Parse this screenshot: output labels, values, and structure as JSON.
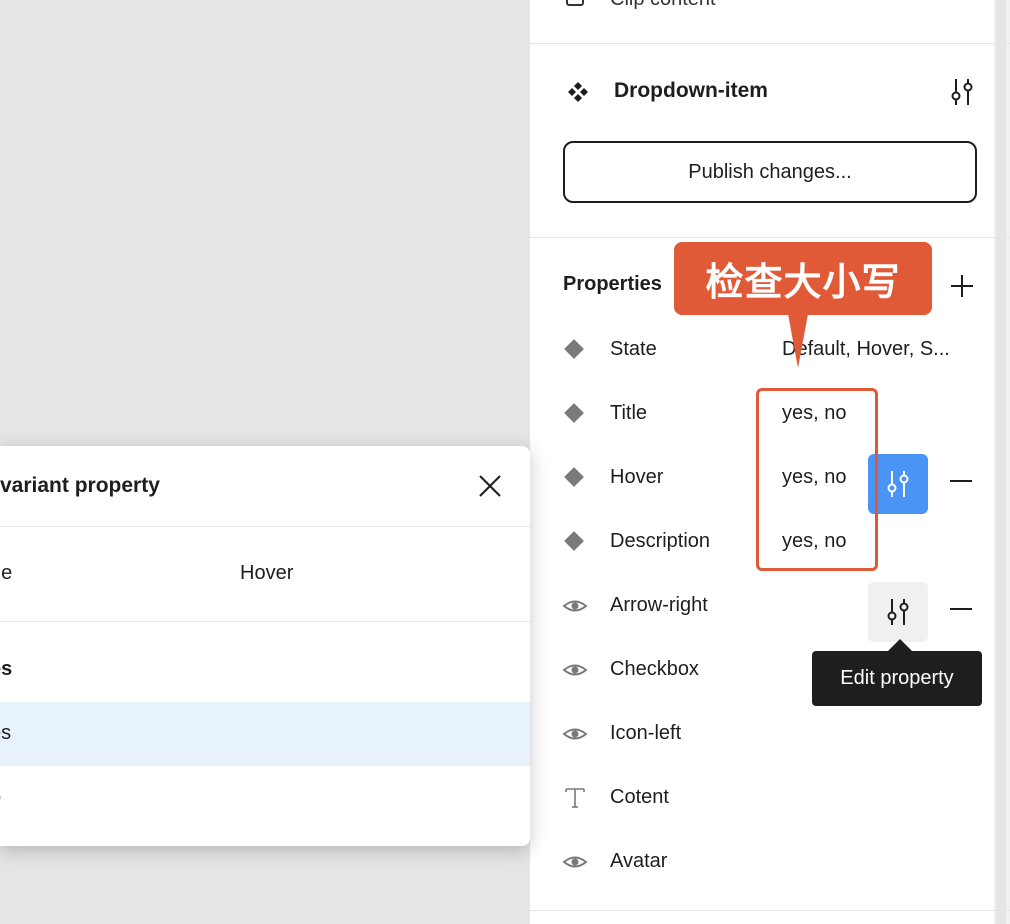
{
  "top_section": {
    "clip_content_label": "Clip content"
  },
  "component": {
    "name": "Dropdown-item",
    "publish_label": "Publish changes..."
  },
  "properties": {
    "heading": "Properties",
    "items": [
      {
        "name": "State",
        "value": "Default, Hover, S...",
        "icon": "variant-diamond-icon"
      },
      {
        "name": "Title",
        "value": "yes, no",
        "icon": "variant-diamond-icon"
      },
      {
        "name": "Hover",
        "value": "yes, no",
        "icon": "variant-diamond-icon"
      },
      {
        "name": "Description",
        "value": "yes, no",
        "icon": "variant-diamond-icon"
      },
      {
        "name": "Arrow-right",
        "value": "",
        "icon": "eye-icon"
      },
      {
        "name": "Checkbox",
        "value": "",
        "icon": "eye-icon"
      },
      {
        "name": "Icon-left",
        "value": "",
        "icon": "eye-icon"
      },
      {
        "name": "Cotent",
        "value": "",
        "icon": "text-icon"
      },
      {
        "name": "Avatar",
        "value": "",
        "icon": "eye-icon"
      }
    ]
  },
  "tooltip": {
    "text": "Edit property"
  },
  "annotation": {
    "text": "检查大小写",
    "color": "#e05a38"
  },
  "dialog": {
    "title": "variant property",
    "name_label": "ne",
    "name_value": "Hover",
    "values": [
      "es",
      "es",
      "o"
    ]
  },
  "colors": {
    "accent": "#4a94f6",
    "annotation": "#e05a38",
    "tooltip_bg": "#1e1e1e"
  }
}
